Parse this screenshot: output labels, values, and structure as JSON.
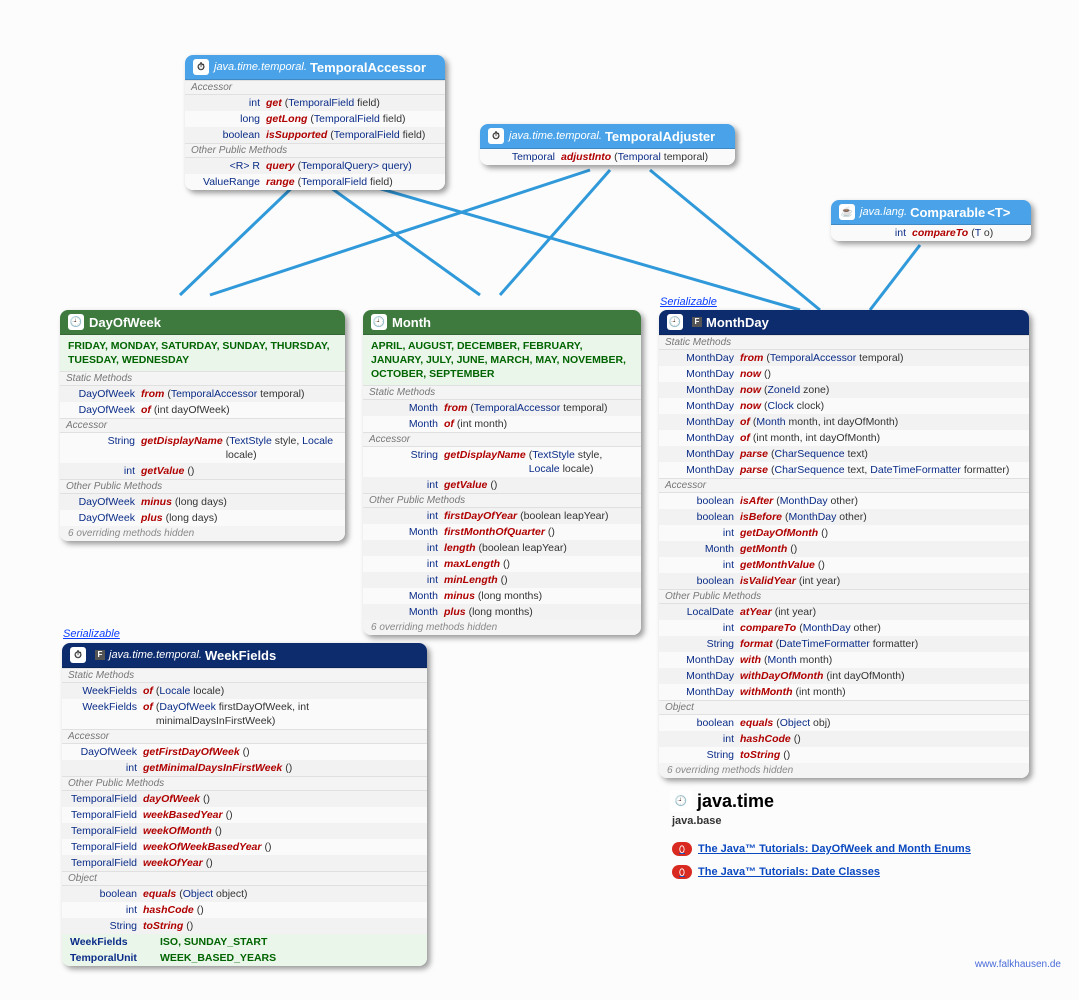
{
  "temporalAccessor": {
    "package": "java.time.temporal.",
    "name": "TemporalAccessor",
    "sections": [
      {
        "label": "Accessor",
        "rows": [
          {
            "ret": "int",
            "name": "get",
            "params": "(TemporalField field)"
          },
          {
            "ret": "long",
            "name": "getLong",
            "params": "(TemporalField field)"
          },
          {
            "ret": "boolean",
            "name": "isSupported",
            "params": "(TemporalField field)"
          }
        ]
      },
      {
        "label": "Other Public Methods",
        "rows": [
          {
            "ret": "<R> R",
            "name": "query",
            "params": "(TemporalQuery<R> query)"
          },
          {
            "ret": "ValueRange",
            "name": "range",
            "params": "(TemporalField field)"
          }
        ]
      }
    ]
  },
  "temporalAdjuster": {
    "package": "java.time.temporal.",
    "name": "TemporalAdjuster",
    "rows": [
      {
        "ret": "Temporal",
        "name": "adjustInto",
        "params": "(Temporal temporal)"
      }
    ]
  },
  "comparable": {
    "package": "java.lang.",
    "name": "Comparable",
    "typeParam": "<T>",
    "rows": [
      {
        "ret": "int",
        "name": "compareTo",
        "params": "(T o)"
      }
    ]
  },
  "dayOfWeek": {
    "name": "DayOfWeek",
    "constants": "FRIDAY, MONDAY, SATURDAY, SUNDAY, THURSDAY, TUESDAY, WEDNESDAY",
    "sections": [
      {
        "label": "Static Methods",
        "rows": [
          {
            "ret": "DayOfWeek",
            "name": "from",
            "params": "(TemporalAccessor temporal)"
          },
          {
            "ret": "DayOfWeek",
            "name": "of",
            "params": "(int dayOfWeek)"
          }
        ]
      },
      {
        "label": "Accessor",
        "rows": [
          {
            "ret": "String",
            "name": "getDisplayName",
            "params": "(TextStyle style, Locale locale)"
          },
          {
            "ret": "int",
            "name": "getValue",
            "params": "()"
          }
        ]
      },
      {
        "label": "Other Public Methods",
        "rows": [
          {
            "ret": "DayOfWeek",
            "name": "minus",
            "params": "(long days)"
          },
          {
            "ret": "DayOfWeek",
            "name": "plus",
            "params": "(long days)"
          }
        ]
      }
    ],
    "hidden": "6 overriding methods hidden"
  },
  "month": {
    "name": "Month",
    "constants": "APRIL, AUGUST, DECEMBER, FEBRUARY, JANUARY, JULY, JUNE, MARCH, MAY, NOVEMBER, OCTOBER, SEPTEMBER",
    "sections": [
      {
        "label": "Static Methods",
        "rows": [
          {
            "ret": "Month",
            "name": "from",
            "params": "(TemporalAccessor temporal)"
          },
          {
            "ret": "Month",
            "name": "of",
            "params": "(int month)"
          }
        ]
      },
      {
        "label": "Accessor",
        "rows": [
          {
            "ret": "String",
            "name": "getDisplayName",
            "params": "(TextStyle style, Locale locale)"
          },
          {
            "ret": "int",
            "name": "getValue",
            "params": "()"
          }
        ]
      },
      {
        "label": "Other Public Methods",
        "rows": [
          {
            "ret": "int",
            "name": "firstDayOfYear",
            "params": "(boolean leapYear)"
          },
          {
            "ret": "Month",
            "name": "firstMonthOfQuarter",
            "params": "()"
          },
          {
            "ret": "int",
            "name": "length",
            "params": "(boolean leapYear)"
          },
          {
            "ret": "int",
            "name": "maxLength",
            "params": "()"
          },
          {
            "ret": "int",
            "name": "minLength",
            "params": "()"
          },
          {
            "ret": "Month",
            "name": "minus",
            "params": "(long months)"
          },
          {
            "ret": "Month",
            "name": "plus",
            "params": "(long months)"
          }
        ]
      }
    ],
    "hidden": "6 overriding methods hidden"
  },
  "monthDay": {
    "name": "MonthDay",
    "stereotype": "Serializable",
    "sections": [
      {
        "label": "Static Methods",
        "rows": [
          {
            "ret": "MonthDay",
            "name": "from",
            "params": "(TemporalAccessor temporal)"
          },
          {
            "ret": "MonthDay",
            "name": "now",
            "params": "()"
          },
          {
            "ret": "MonthDay",
            "name": "now",
            "params": "(ZoneId zone)"
          },
          {
            "ret": "MonthDay",
            "name": "now",
            "params": "(Clock clock)"
          },
          {
            "ret": "MonthDay",
            "name": "of",
            "params": "(Month month, int dayOfMonth)"
          },
          {
            "ret": "MonthDay",
            "name": "of",
            "params": "(int month, int dayOfMonth)"
          },
          {
            "ret": "MonthDay",
            "name": "parse",
            "params": "(CharSequence text)"
          },
          {
            "ret": "MonthDay",
            "name": "parse",
            "params": "(CharSequence text, DateTimeFormatter formatter)"
          }
        ]
      },
      {
        "label": "Accessor",
        "rows": [
          {
            "ret": "boolean",
            "name": "isAfter",
            "params": "(MonthDay other)"
          },
          {
            "ret": "boolean",
            "name": "isBefore",
            "params": "(MonthDay other)"
          },
          {
            "ret": "int",
            "name": "getDayOfMonth",
            "params": "()"
          },
          {
            "ret": "Month",
            "name": "getMonth",
            "params": "()"
          },
          {
            "ret": "int",
            "name": "getMonthValue",
            "params": "()"
          },
          {
            "ret": "boolean",
            "name": "isValidYear",
            "params": "(int year)"
          }
        ]
      },
      {
        "label": "Other Public Methods",
        "rows": [
          {
            "ret": "LocalDate",
            "name": "atYear",
            "params": "(int year)"
          },
          {
            "ret": "int",
            "name": "compareTo",
            "params": "(MonthDay other)"
          },
          {
            "ret": "String",
            "name": "format",
            "params": "(DateTimeFormatter formatter)"
          },
          {
            "ret": "MonthDay",
            "name": "with",
            "params": "(Month month)"
          },
          {
            "ret": "MonthDay",
            "name": "withDayOfMonth",
            "params": "(int dayOfMonth)"
          },
          {
            "ret": "MonthDay",
            "name": "withMonth",
            "params": "(int month)"
          }
        ]
      },
      {
        "label": "Object",
        "rows": [
          {
            "ret": "boolean",
            "name": "equals",
            "params": "(Object obj)"
          },
          {
            "ret": "int",
            "name": "hashCode",
            "params": "()"
          },
          {
            "ret": "String",
            "name": "toString",
            "params": "()"
          }
        ]
      }
    ],
    "hidden": "6 overriding methods hidden"
  },
  "weekFields": {
    "package": "java.time.temporal.",
    "name": "WeekFields",
    "stereotype": "Serializable",
    "sections": [
      {
        "label": "Static Methods",
        "rows": [
          {
            "ret": "WeekFields",
            "name": "of",
            "params": "(Locale locale)"
          },
          {
            "ret": "WeekFields",
            "name": "of",
            "params": "(DayOfWeek firstDayOfWeek, int minimalDaysInFirstWeek)"
          }
        ]
      },
      {
        "label": "Accessor",
        "rows": [
          {
            "ret": "DayOfWeek",
            "name": "getFirstDayOfWeek",
            "params": "()"
          },
          {
            "ret": "int",
            "name": "getMinimalDaysInFirstWeek",
            "params": "()"
          }
        ]
      },
      {
        "label": "Other Public Methods",
        "rows": [
          {
            "ret": "TemporalField",
            "name": "dayOfWeek",
            "params": "()"
          },
          {
            "ret": "TemporalField",
            "name": "weekBasedYear",
            "params": "()"
          },
          {
            "ret": "TemporalField",
            "name": "weekOfMonth",
            "params": "()"
          },
          {
            "ret": "TemporalField",
            "name": "weekOfWeekBasedYear",
            "params": "()"
          },
          {
            "ret": "TemporalField",
            "name": "weekOfYear",
            "params": "()"
          }
        ]
      },
      {
        "label": "Object",
        "rows": [
          {
            "ret": "boolean",
            "name": "equals",
            "params": "(Object object)"
          },
          {
            "ret": "int",
            "name": "hashCode",
            "params": "()"
          },
          {
            "ret": "String",
            "name": "toString",
            "params": "()"
          }
        ]
      }
    ],
    "footerRows": [
      {
        "label": "WeekFields",
        "vals": "ISO, SUNDAY_START"
      },
      {
        "label": "TemporalUnit",
        "vals": "WEEK_BASED_YEARS"
      }
    ]
  },
  "pkg": {
    "name": "java.time",
    "module": "java.base"
  },
  "tutorials": [
    "The Java™ Tutorials: DayOfWeek and Month Enums",
    "The Java™ Tutorials: Date Classes"
  ],
  "footerLink": "www.falkhausen.de"
}
